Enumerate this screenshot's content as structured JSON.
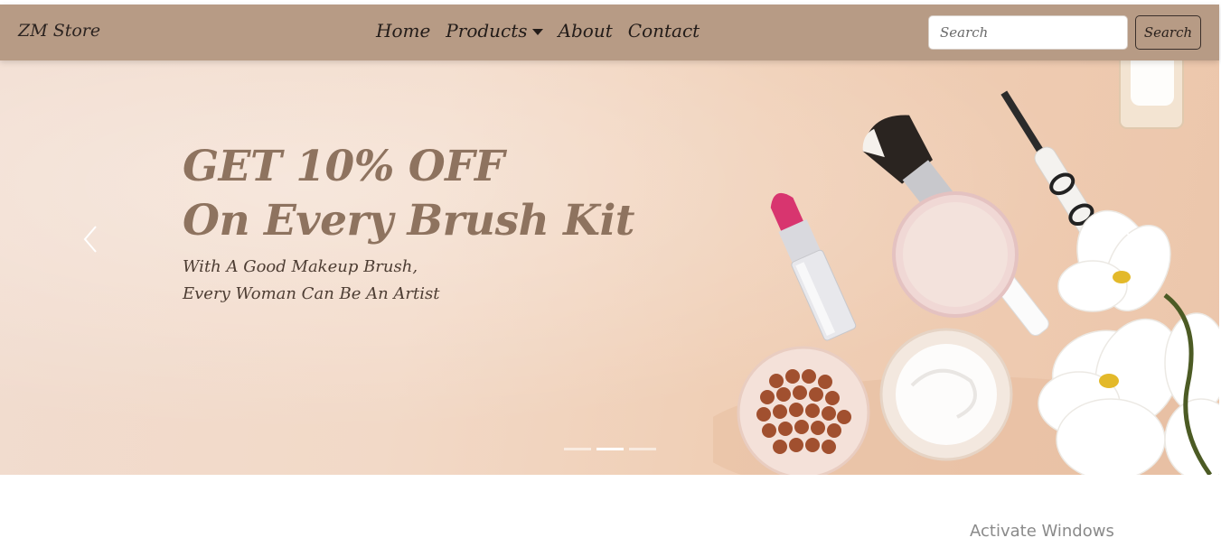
{
  "brand": {
    "label": "ZM Store"
  },
  "nav": {
    "items": [
      {
        "label": "Home"
      },
      {
        "label": "Products",
        "has_dropdown": true
      },
      {
        "label": "About"
      },
      {
        "label": "Contact"
      }
    ]
  },
  "search": {
    "placeholder": "Search",
    "value": "",
    "button_label": "Search"
  },
  "hero": {
    "heading_line1": "GET 10% OFF",
    "heading_line2": "On Every Brush Kit",
    "sub_line1": "With A Good Makeup Brush,",
    "sub_line2": "Every Woman Can Be An Artist",
    "active_slide": 2,
    "slide_count": 3
  },
  "icons": {
    "prev": "chevron-left-icon",
    "next": "chevron-right-icon",
    "dropdown": "caret-down-icon"
  },
  "watermark": {
    "text": "Activate Windows"
  },
  "colors": {
    "navbar": "#b79b85",
    "heading": "#8e735f",
    "subtext": "#4d3d33"
  }
}
